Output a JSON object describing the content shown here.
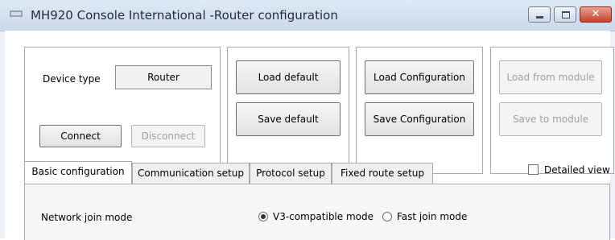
{
  "window": {
    "title": "MH920 Console International -Router configuration"
  },
  "device": {
    "type_label": "Device type",
    "type_value": "Router",
    "connect_label": "Connect",
    "disconnect_label": "Disconnect"
  },
  "defaults": {
    "load_label": "Load default",
    "save_label": "Save default"
  },
  "configuration": {
    "load_label": "Load Configuration",
    "save_label": "Save Configuration"
  },
  "module": {
    "load_label": "Load from module",
    "save_label": "Save to module"
  },
  "tabs": [
    {
      "label": "Basic configuration"
    },
    {
      "label": "Communication setup"
    },
    {
      "label": "Protocol setup"
    },
    {
      "label": "Fixed route setup"
    }
  ],
  "detailed_view": {
    "label": "Detailed view",
    "checked": false
  },
  "basic": {
    "network_join_label": "Network join mode",
    "options": [
      {
        "label": "V3-compatible mode",
        "checked": true
      },
      {
        "label": "Fast join mode",
        "checked": false
      }
    ]
  }
}
